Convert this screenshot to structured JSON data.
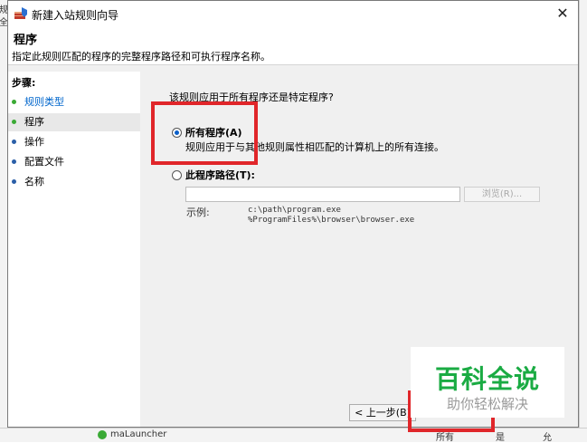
{
  "background": {
    "left_fragments": [
      "规",
      "全"
    ],
    "bottom_left_text": "maLauncher",
    "bottom_right_texts": [
      "所有",
      "是",
      "允"
    ]
  },
  "dialog": {
    "title": "新建入站规则向导",
    "close_glyph": "✕",
    "header": {
      "title": "程序",
      "description": "指定此规则匹配的程序的完整程序路径和可执行程序名称。"
    },
    "steps": {
      "title": "步骤:",
      "items": [
        {
          "label": "规则类型",
          "dot_color": "#3aaa35",
          "text_color": "#0066cc"
        },
        {
          "label": "程序",
          "dot_color": "#3aaa35",
          "text_color": "#000000"
        },
        {
          "label": "操作",
          "dot_color": "#2b5fa8",
          "text_color": "#000000"
        },
        {
          "label": "配置文件",
          "dot_color": "#2b5fa8",
          "text_color": "#000000"
        },
        {
          "label": "名称",
          "dot_color": "#2b5fa8",
          "text_color": "#000000"
        }
      ],
      "active_index": 1
    },
    "question": "该规则应用于所有程序还是特定程序?",
    "options": {
      "all_programs": {
        "label": "所有程序(A)",
        "description": "规则应用于与其他规则属性相匹配的计算机上的所有连接。",
        "selected": true
      },
      "program_path": {
        "label": "此程序路径(T):",
        "selected": false,
        "input_value": "",
        "browse_label": "浏览(R)...",
        "example_label": "示例:",
        "example_lines": [
          "c:\\path\\program.exe",
          "%ProgramFiles%\\browser\\browser.exe"
        ]
      }
    },
    "buttons": {
      "back": "< 上一步(B)"
    },
    "highlight_color": "#e0262a"
  },
  "watermark": {
    "title": "百科全说",
    "subtitle": "助你轻松解决",
    "title_color": "#1aab43"
  }
}
